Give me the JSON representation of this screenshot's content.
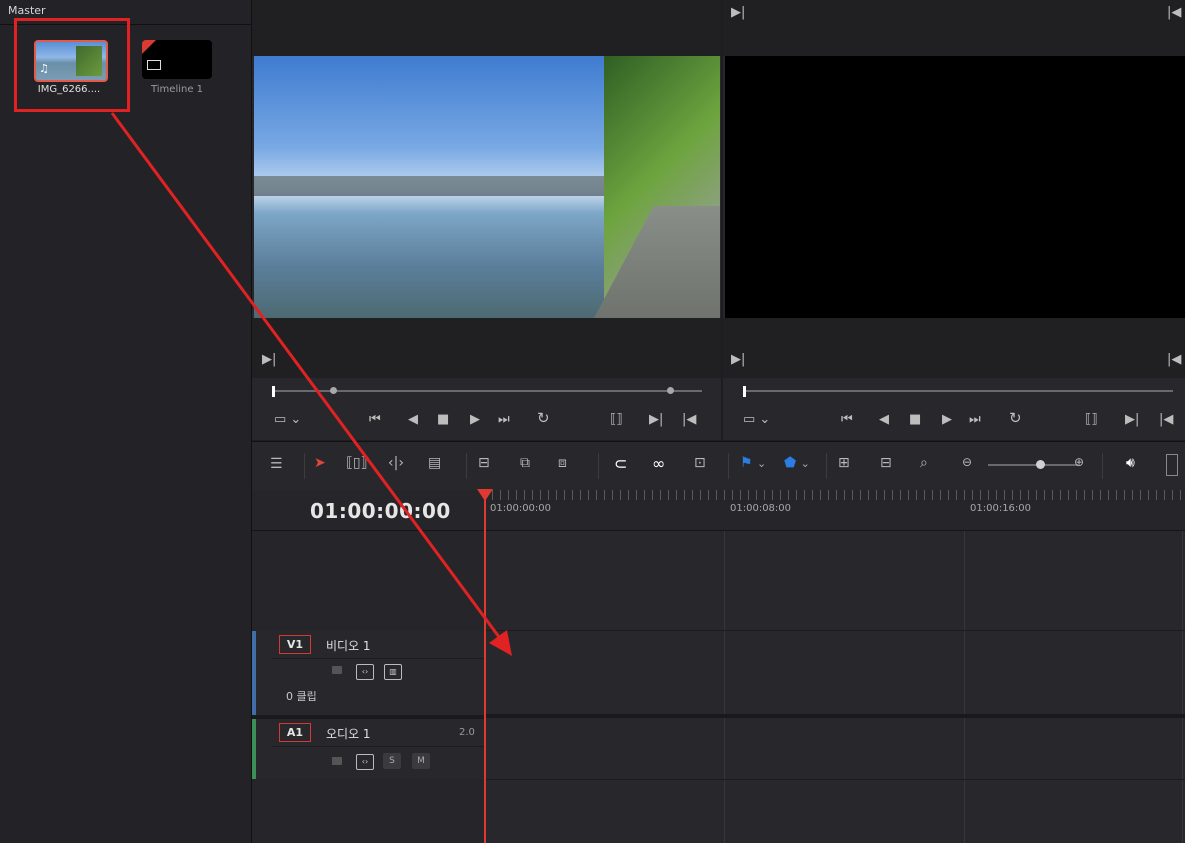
{
  "media_pool": {
    "title": "Master",
    "clips": [
      {
        "label": "IMG_6266....",
        "type": "video-clip",
        "selected": true
      },
      {
        "label": "Timeline 1",
        "type": "timeline"
      }
    ]
  },
  "viewers": {
    "source_icon": "in-marker-icon",
    "timeline_icon": "in-marker-icon"
  },
  "timeline": {
    "timecode": "01:00:00:00",
    "ruler_ticks": [
      "01:00:00:00",
      "01:00:08:00",
      "01:00:16:00"
    ],
    "tracks": {
      "video": {
        "badge": "V1",
        "name": "비디오 1",
        "clip_count": "0 클립"
      },
      "audio": {
        "badge": "A1",
        "name": "오디오 1",
        "channel": "2.0",
        "solo": "S",
        "mute": "M"
      }
    }
  },
  "colors": {
    "accent_red": "#e03a30",
    "annotation_red": "#e02222",
    "video_track": "#3f6ea8",
    "audio_track": "#3d8f5a",
    "marker_blue": "#2a7de1"
  }
}
